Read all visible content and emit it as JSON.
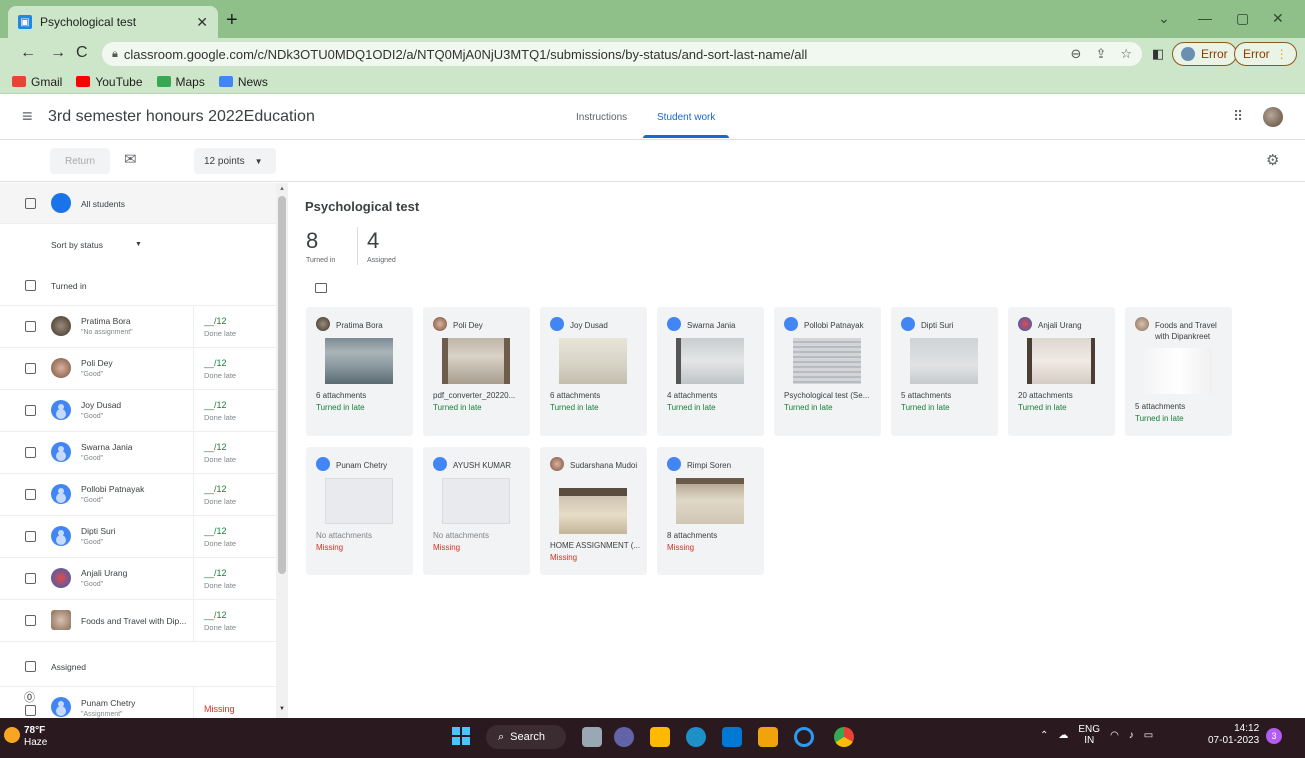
{
  "browser": {
    "tab_title": "Psychological test",
    "url": "classroom.google.com/c/NDk3OTU0MDQ1ODI2/a/NTQ0MjA0NjU3MTQ1/submissions/by-status/and-sort-last-name/all",
    "error_label_1": "Error",
    "error_label_2": "Error",
    "bookmarks": [
      "Gmail",
      "YouTube",
      "Maps",
      "News"
    ]
  },
  "header": {
    "class_name": "3rd semester honours 2022Education",
    "tabs": [
      "Instructions",
      "Student work"
    ],
    "active_tab": "Student work"
  },
  "toolbar": {
    "return_label": "Return",
    "points": "12 points"
  },
  "sidebar": {
    "all_students": "All students",
    "sort_label": "Sort by status",
    "turned_in_heading": "Turned in",
    "assigned_heading": "Assigned",
    "students": [
      {
        "name": "Pratima Bora",
        "note": "\"No assignment\"",
        "grade": "__/12",
        "status": "Done late"
      },
      {
        "name": "Poli Dey",
        "note": "\"Good\"",
        "grade": "__/12",
        "status": "Done late"
      },
      {
        "name": "Joy Dusad",
        "note": "\"Good\"",
        "grade": "__/12",
        "status": "Done late"
      },
      {
        "name": "Swarna Jania",
        "note": "\"Good\"",
        "grade": "__/12",
        "status": "Done late"
      },
      {
        "name": "Pollobi Patnayak",
        "note": "\"Good\"",
        "grade": "__/12",
        "status": "Done late"
      },
      {
        "name": "Dipti Suri",
        "note": "\"Good\"",
        "grade": "__/12",
        "status": "Done late"
      },
      {
        "name": "Anjali Urang",
        "note": "\"Good\"",
        "grade": "__/12",
        "status": "Done late"
      },
      {
        "name": "Foods and Travel with Dip...",
        "note": "",
        "grade": "__/12",
        "status": "Done late"
      }
    ],
    "assigned_students": [
      {
        "name": "Punam Chetry",
        "note": "\"Assignment\"",
        "status": "Missing"
      }
    ]
  },
  "main": {
    "assignment_title": "Psychological test",
    "turned_in_count": "8",
    "turned_in_label": "Turned in",
    "assigned_count": "4",
    "assigned_label": "Assigned",
    "cards_row1": [
      {
        "name": "Pratima Bora",
        "attach": "6 attachments",
        "status": "Turned in late"
      },
      {
        "name": "Poli Dey",
        "attach": "pdf_converter_20220...",
        "status": "Turned in late"
      },
      {
        "name": "Joy Dusad",
        "attach": "6 attachments",
        "status": "Turned in late"
      },
      {
        "name": "Swarna Jania",
        "attach": "4 attachments",
        "status": "Turned in late"
      },
      {
        "name": "Pollobi Patnayak",
        "attach": "Psychological test (Se...",
        "status": "Turned in late"
      },
      {
        "name": "Dipti Suri",
        "attach": "5 attachments",
        "status": "Turned in late"
      },
      {
        "name": "Anjali Urang",
        "attach": "20 attachments",
        "status": "Turned in late"
      },
      {
        "name": "Foods and Travel with Dipankreet",
        "attach": "5 attachments",
        "status": "Turned in late"
      }
    ],
    "cards_row2": [
      {
        "name": "Punam Chetry",
        "attach": "No attachments",
        "status": "Missing"
      },
      {
        "name": "AYUSH KUMAR",
        "attach": "No attachments",
        "status": "Missing"
      },
      {
        "name": "Sudarshana Mudoi",
        "attach": "HOME ASSIGNMENT (...",
        "status": "Missing"
      },
      {
        "name": "Rimpi Soren",
        "attach": "8 attachments",
        "status": "Missing"
      }
    ]
  },
  "taskbar": {
    "temp": "78°F",
    "weather": "Haze",
    "search": "Search",
    "lang_top": "ENG",
    "lang_bottom": "IN",
    "time": "14:12",
    "date": "07-01-2023",
    "notifications": "3"
  }
}
